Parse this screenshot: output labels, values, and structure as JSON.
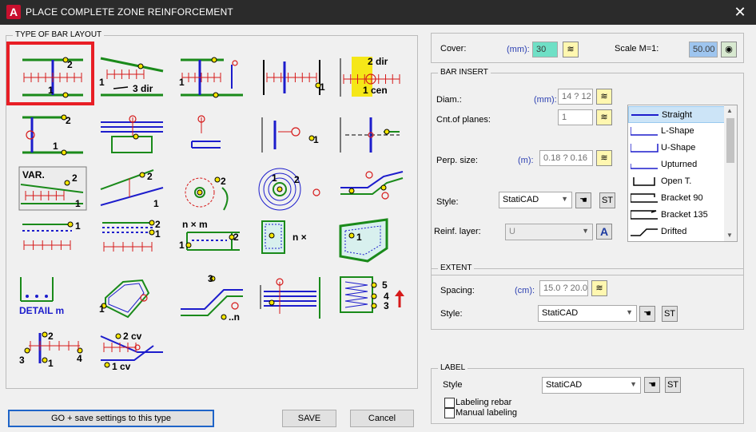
{
  "window": {
    "title": "PLACE COMPLETE ZONE REINFORCEMENT",
    "app_icon": "A"
  },
  "layout_group": {
    "legend": "TYPE OF BAR LAYOUT",
    "icons": [
      "straight-two-ends",
      "sloped-three-dir",
      "single-end-bar",
      "bar-between-walls",
      "center-direction",
      "hook-left",
      "stirrup-cross",
      "single-hook-down",
      "hook-vertical-right",
      "cross-bars",
      "variable-length",
      "sloped-variable",
      "circular-arc",
      "circular-rings",
      "curved-layer",
      "dotted-one",
      "dotted-two",
      "n-by-m-grid",
      "n-by-box",
      "polygon-box",
      "detail-m",
      "polygon-curve",
      "stepped-bar",
      "vertical-group",
      "spring-layout",
      "four-point",
      "two-cv"
    ],
    "icon_texts": {
      "dir2": "2 dir",
      "cen1": "1 cen",
      "dir3": "3 dir",
      "var": "VAR.",
      "nxm": "n × m",
      "nx": "n ×",
      "detail": "DETAIL m",
      "cv2": "2 cv",
      "cv1": "1 cv",
      "n": "n"
    }
  },
  "cover": {
    "label": "Cover:",
    "unit": "(mm):",
    "value": "30"
  },
  "scale": {
    "label": "Scale M=1:",
    "value": "50.00"
  },
  "bar_insert": {
    "legend": "BAR INSERT",
    "diam": {
      "label": "Diam.:",
      "unit": "(mm):",
      "value": "14 ? 12"
    },
    "planes": {
      "label": "Cnt.of planes:",
      "value": "1"
    },
    "perp": {
      "label": "Perp. size:",
      "unit": "(m):",
      "value": "0.18 ? 0.16"
    },
    "style": {
      "label": "Style:",
      "value": "StatiCAD",
      "st": "ST"
    },
    "layer": {
      "label": "Reinf. layer:",
      "value": "U",
      "a": "A"
    }
  },
  "shape_list": {
    "items": [
      "Straight",
      "L-Shape",
      "U-Shape",
      "Upturned",
      "Open T.",
      "Bracket 90",
      "Bracket 135",
      "Drifted"
    ],
    "selected": "Straight"
  },
  "extent": {
    "legend": "EXTENT",
    "spacing": {
      "label": "Spacing:",
      "unit": "(cm):",
      "value": "15.0 ? 20.0"
    },
    "style": {
      "label": "Style:",
      "value": "StatiCAD",
      "st": "ST"
    }
  },
  "label_group": {
    "legend": "LABEL",
    "style": {
      "label": "Style",
      "value": "StatiCAD",
      "st": "ST"
    },
    "labeling_rebar": "Labeling rebar",
    "manual_labeling": "Manual labeling"
  },
  "buttons": {
    "go": "GO + save settings to this type",
    "save": "SAVE",
    "cancel": "Cancel"
  },
  "colors": {
    "bar_green": "#1a8a1a",
    "bar_blue": "#1c1ccc",
    "mark_red": "#d61a1a",
    "dot_yellow": "#f5e600",
    "select_red": "#e81e25"
  }
}
